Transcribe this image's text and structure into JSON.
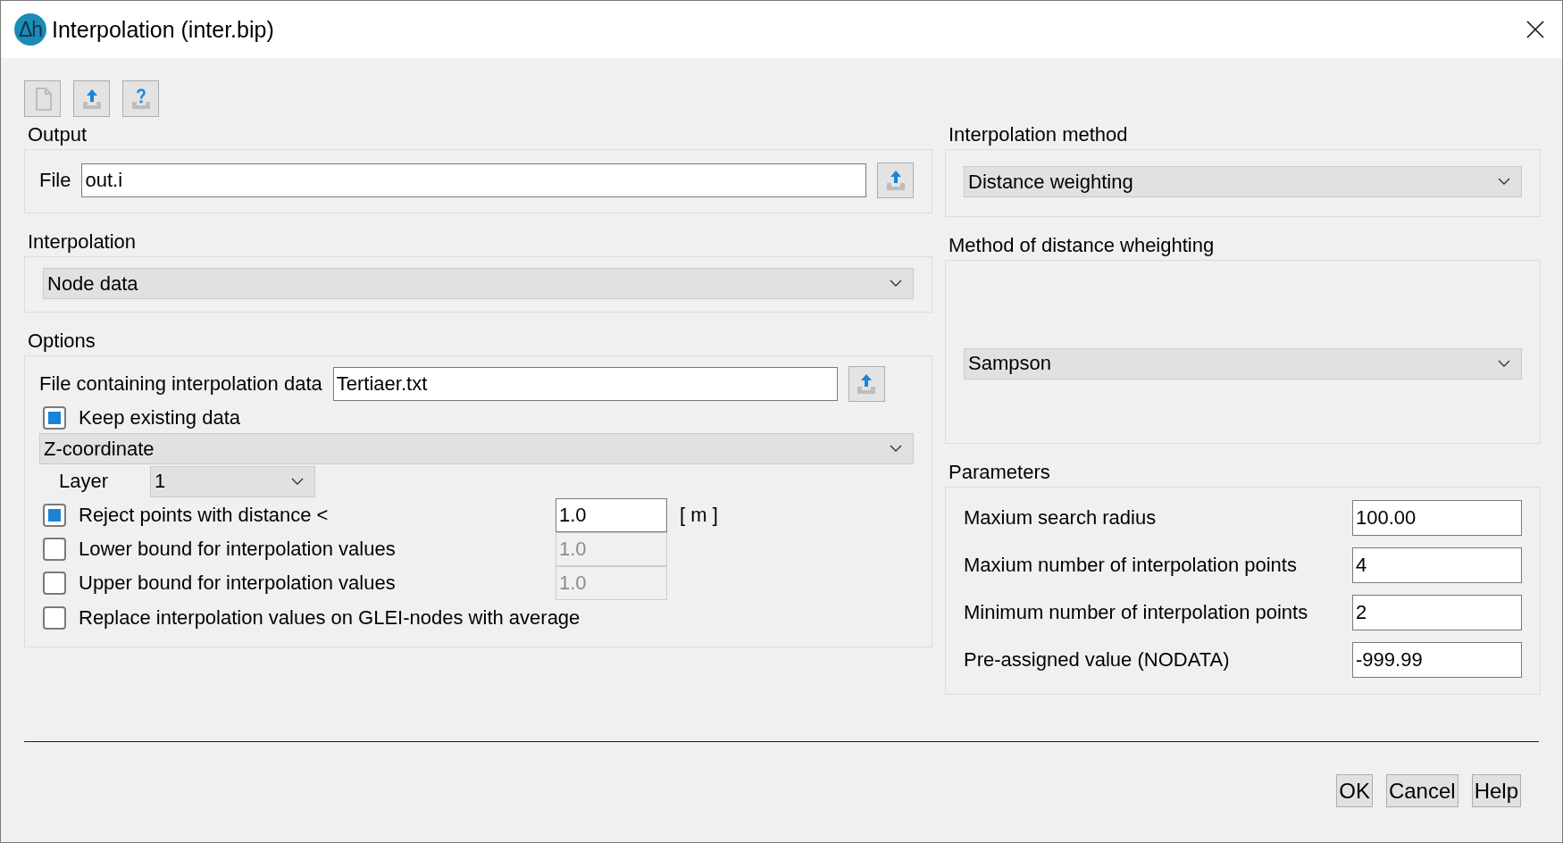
{
  "window": {
    "logo_text": "Δh",
    "title": "Interpolation (inter.bip)"
  },
  "toolbar": [
    {
      "kind": "new",
      "disabled": true
    },
    {
      "kind": "load",
      "disabled": false
    },
    {
      "kind": "query",
      "disabled": false
    }
  ],
  "output": {
    "title": "Output",
    "file_label": "File",
    "file_value": "out.i"
  },
  "interpolation": {
    "title": "Interpolation",
    "selection": "Node data"
  },
  "options": {
    "title": "Options",
    "data_file_label": "File containing interpolation data",
    "data_file_value": "Tertiaer.txt",
    "keep_existing": {
      "label": "Keep existing data",
      "checked": true
    },
    "coordinate": "Z-coordinate",
    "layer_label": "Layer",
    "layer": "1",
    "rows": [
      {
        "label": "Reject points with distance <",
        "checked": true,
        "value": "1.0",
        "unit": "[ m ]"
      },
      {
        "label": "Lower bound for interpolation values",
        "checked": false,
        "value": "1.0"
      },
      {
        "label": "Upper bound for interpolation values",
        "checked": false,
        "value": "1.0"
      },
      {
        "label": "Replace interpolation values on GLEI-nodes with average",
        "checked": false
      }
    ]
  },
  "method": {
    "title": "Interpolation method",
    "selection": "Distance weighting"
  },
  "distance_method": {
    "title": "Method of distance wheighting",
    "selection": "Sampson"
  },
  "parameters": {
    "title": "Parameters",
    "rows": [
      {
        "label": "Maxium search radius",
        "value": "100.00"
      },
      {
        "label": "Maxium number of interpolation points",
        "value": "4"
      },
      {
        "label": "Minimum number of interpolation points",
        "value": "2"
      },
      {
        "label": "Pre-assigned value (NODATA)",
        "value": "-999.99"
      }
    ]
  },
  "buttons": [
    "OK",
    "Cancel",
    "Help"
  ]
}
